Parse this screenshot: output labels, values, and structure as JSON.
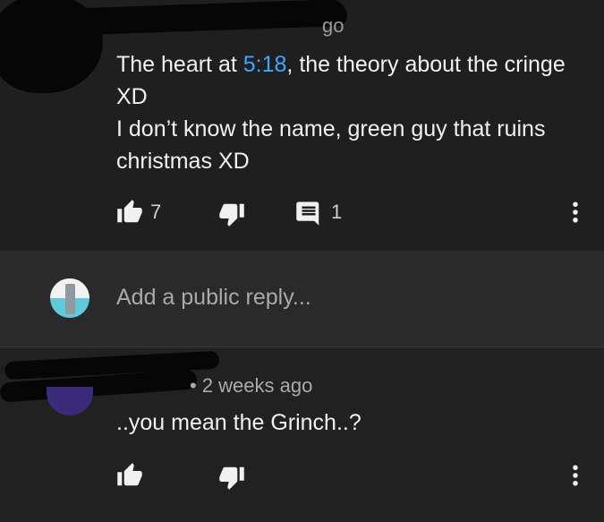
{
  "comment": {
    "meta_fragment": "go",
    "text_before": "The heart at ",
    "timestamp_link": "5:18",
    "text_after": ", the theory about the cringe XD\nI don’t know the name, green guy that ruins christmas XD",
    "likes": "7",
    "replies_count": "1"
  },
  "reply_box": {
    "placeholder": "Add a public reply..."
  },
  "reply": {
    "meta": "• 2 weeks ago",
    "text": "..you mean the Grinch..?"
  },
  "icons": {
    "like": "thumbs-up-icon",
    "dislike": "thumbs-down-icon",
    "reply": "comment-icon",
    "more": "more-vertical-icon"
  },
  "colors": {
    "link": "#3ea6ff",
    "background": "#212121",
    "reply_bar": "#2a2a2a"
  }
}
